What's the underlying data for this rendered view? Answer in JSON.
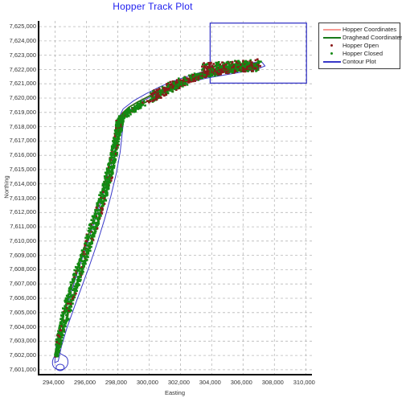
{
  "chart_data": {
    "type": "scatter",
    "title": "Hopper Track Plot",
    "xlabel": "Easting",
    "ylabel": "Northing",
    "xlim": [
      293000,
      310500
    ],
    "ylim": [
      7600600,
      7625400
    ],
    "xticks": [
      "294,000",
      "296,000",
      "298,000",
      "300,000",
      "302,000",
      "304,000",
      "306,000",
      "308,000",
      "310,000"
    ],
    "xtick_values": [
      294000,
      296000,
      298000,
      300000,
      302000,
      304000,
      306000,
      308000,
      310000
    ],
    "yticks": [
      "7,625,000",
      "7,624,000",
      "7,623,000",
      "7,622,000",
      "7,621,000",
      "7,620,000",
      "7,619,000",
      "7,618,000",
      "7,617,000",
      "7,616,000",
      "7,615,000",
      "7,614,000",
      "7,613,000",
      "7,612,000",
      "7,611,000",
      "7,610,000",
      "7,609,000",
      "7,608,000",
      "7,607,000",
      "7,606,000",
      "7,605,000",
      "7,604,000",
      "7,603,000",
      "7,602,000",
      "7,601,000"
    ],
    "ytick_values": [
      7625000,
      7624000,
      7623000,
      7622000,
      7621000,
      7620000,
      7619000,
      7618000,
      7617000,
      7616000,
      7615000,
      7614000,
      7613000,
      7612000,
      7611000,
      7610000,
      7609000,
      7608000,
      7607000,
      7606000,
      7605000,
      7604000,
      7603000,
      7602000,
      7601000
    ],
    "grid": true,
    "legend_position": "outside-top-right",
    "title_color": "#2020ee",
    "series": [
      {
        "name": "Hopper Coordinates",
        "type": "line",
        "color": "#f79a93",
        "marker": "none"
      },
      {
        "name": "Draghead Coordinates",
        "type": "line",
        "color": "#1a7a1a",
        "marker": "none"
      },
      {
        "name": "Hopper Open",
        "type": "scatter",
        "color": "#8b1a1a",
        "marker": "dot"
      },
      {
        "name": "Hopper Closed",
        "type": "scatter",
        "color": "#138a13",
        "marker": "dot"
      },
      {
        "name": "Contour Plot",
        "type": "line",
        "color": "#3838c8",
        "marker": "none"
      }
    ],
    "annotations": [
      {
        "name": "contour-boundary-rectangle",
        "x0": 303900,
        "y0": 7621050,
        "x1": 310050,
        "y1": 7625250
      },
      {
        "name": "contour-loop-southwest",
        "x0": 293950,
        "y0": 7601050,
        "x1": 294700,
        "y1": 7602050
      }
    ],
    "track_description": "Dense hopper/draghead track running from the south-west corner (~294,100 E / 7,601,900 N) north-east, steepening to a knee near 298,000 E / 7,618,600 N, then flattening east toward a dense dump cluster around 303,500-307,000 E / 7,621,800-7,622,400 N.",
    "track_path_main": [
      [
        294100,
        7601900
      ],
      [
        294200,
        7602500
      ],
      [
        294500,
        7603800
      ],
      [
        294900,
        7605200
      ],
      [
        295300,
        7606600
      ],
      [
        295750,
        7608100
      ],
      [
        296200,
        7609600
      ],
      [
        296650,
        7611100
      ],
      [
        297050,
        7612500
      ],
      [
        297400,
        7613900
      ],
      [
        297700,
        7615300
      ],
      [
        297950,
        7616700
      ],
      [
        298100,
        7617800
      ],
      [
        298200,
        7618400
      ],
      [
        298450,
        7618800
      ],
      [
        298900,
        7619150
      ],
      [
        299500,
        7619550
      ],
      [
        300200,
        7619950
      ],
      [
        300900,
        7620350
      ],
      [
        301600,
        7620750
      ],
      [
        302300,
        7621100
      ],
      [
        303000,
        7621420
      ],
      [
        303700,
        7621680
      ],
      [
        304400,
        7621900
      ],
      [
        305100,
        7622060
      ],
      [
        305800,
        7622180
      ],
      [
        306400,
        7622260
      ],
      [
        306900,
        7622300
      ]
    ],
    "track_path_return": [
      [
        306900,
        7622300
      ],
      [
        306300,
        7622150
      ],
      [
        305600,
        7622010
      ],
      [
        304900,
        7621880
      ],
      [
        304200,
        7621760
      ],
      [
        303500,
        7621640
      ],
      [
        302800,
        7621480
      ],
      [
        302100,
        7621230
      ],
      [
        301400,
        7620900
      ],
      [
        300700,
        7620520
      ],
      [
        300000,
        7620130
      ],
      [
        299300,
        7619740
      ],
      [
        298700,
        7619350
      ],
      [
        298300,
        7618950
      ],
      [
        298050,
        7618500
      ],
      [
        297900,
        7617600
      ],
      [
        297650,
        7616200
      ],
      [
        297350,
        7614800
      ],
      [
        297000,
        7613400
      ],
      [
        296600,
        7612000
      ],
      [
        296150,
        7610500
      ],
      [
        295700,
        7609000
      ],
      [
        295250,
        7607500
      ],
      [
        294800,
        7606000
      ],
      [
        294450,
        7604600
      ],
      [
        294200,
        7603200
      ],
      [
        294100,
        7602100
      ]
    ],
    "contour_envelope_outer": [
      [
        293980,
        7601500
      ],
      [
        294080,
        7602900
      ],
      [
        294450,
        7604400
      ],
      [
        294900,
        7606000
      ],
      [
        295400,
        7607700
      ],
      [
        295950,
        7609500
      ],
      [
        296500,
        7611300
      ],
      [
        297000,
        7613000
      ],
      [
        297450,
        7614700
      ],
      [
        297800,
        7616300
      ],
      [
        298000,
        7617700
      ],
      [
        298050,
        7618600
      ],
      [
        298350,
        7619250
      ],
      [
        299000,
        7619800
      ],
      [
        299800,
        7620300
      ],
      [
        300700,
        7620800
      ],
      [
        301700,
        7621250
      ],
      [
        302800,
        7621650
      ],
      [
        303900,
        7621980
      ],
      [
        305000,
        7622250
      ],
      [
        306200,
        7622450
      ],
      [
        307200,
        7622520
      ],
      [
        307400,
        7622250
      ],
      [
        306800,
        7621980
      ],
      [
        305800,
        7621800
      ],
      [
        304700,
        7621600
      ],
      [
        303600,
        7621380
      ],
      [
        302500,
        7621080
      ],
      [
        301400,
        7620700
      ],
      [
        300400,
        7620250
      ],
      [
        299500,
        7619750
      ],
      [
        298800,
        7619200
      ],
      [
        298400,
        7618600
      ],
      [
        298300,
        7617700
      ],
      [
        298150,
        7616200
      ],
      [
        297900,
        7614700
      ],
      [
        297550,
        7613100
      ],
      [
        297150,
        7611500
      ],
      [
        296700,
        7609900
      ],
      [
        296200,
        7608300
      ],
      [
        295700,
        7606800
      ],
      [
        295200,
        7605300
      ],
      [
        294750,
        7603900
      ],
      [
        294400,
        7602600
      ],
      [
        294200,
        7601600
      ]
    ]
  }
}
